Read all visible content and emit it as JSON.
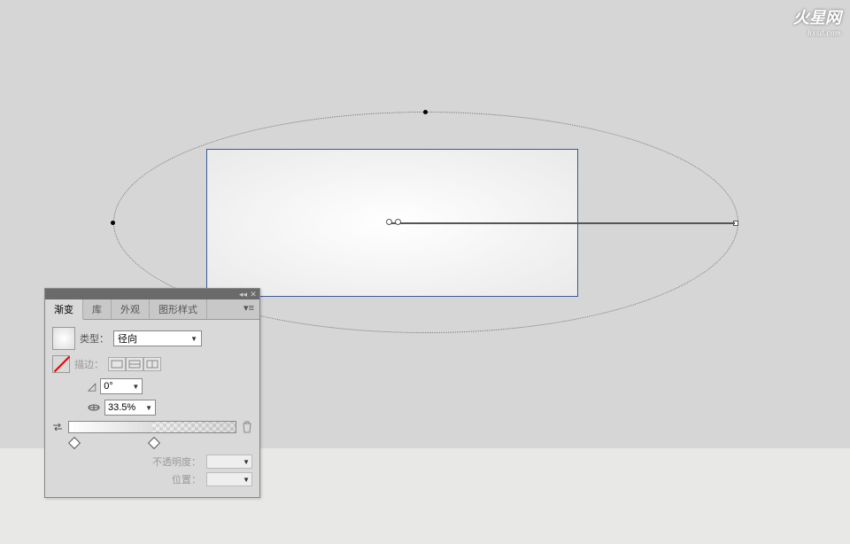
{
  "watermark": {
    "title": "火星网",
    "sub": "hxsd.com"
  },
  "panel": {
    "tabs": {
      "gradient": "渐变",
      "library": "库",
      "appearance": "外观",
      "graphic_styles": "图形样式"
    },
    "type_label": "类型：",
    "type_value": "径向",
    "stroke_label": "描边：",
    "angle_value": "0°",
    "aspect_value": "33.5%",
    "opacity_label": "不透明度：",
    "location_label": "位置："
  }
}
